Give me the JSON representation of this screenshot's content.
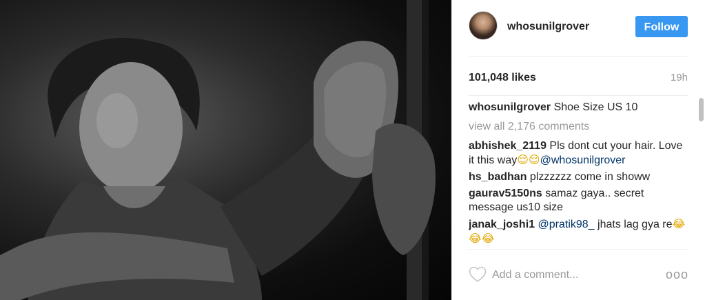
{
  "post": {
    "username": "whosunilgrover",
    "follow_label": "Follow",
    "likes": "101,048 likes",
    "time": "19h",
    "caption": {
      "user": "whosunilgrover",
      "text": "Shoe Size US 10"
    },
    "view_all": "view all 2,176 comments",
    "comments": [
      {
        "user": "abhishek_2119",
        "text": "Pls dont cut your hair. Love it this way",
        "emoji": "😌😌",
        "mention": "@whosunilgrover"
      },
      {
        "user": "hs_badhan",
        "text": "plzzzzzz come in showw"
      },
      {
        "user": "gaurav5150ns",
        "text": "samaz gaya.. secret message us10 size"
      },
      {
        "user": "janak_joshi1",
        "mention": "@pratik98_",
        "text": "jhats lag gya re",
        "emoji": "😂😂😂"
      }
    ],
    "add_comment_placeholder": "Add a comment...",
    "more_label": "ooo"
  },
  "colors": {
    "follow": "#3897f0",
    "muted": "#999999",
    "mention": "#003569"
  },
  "icons": {
    "like": "heart-outline-icon",
    "more": "more-options-icon"
  }
}
